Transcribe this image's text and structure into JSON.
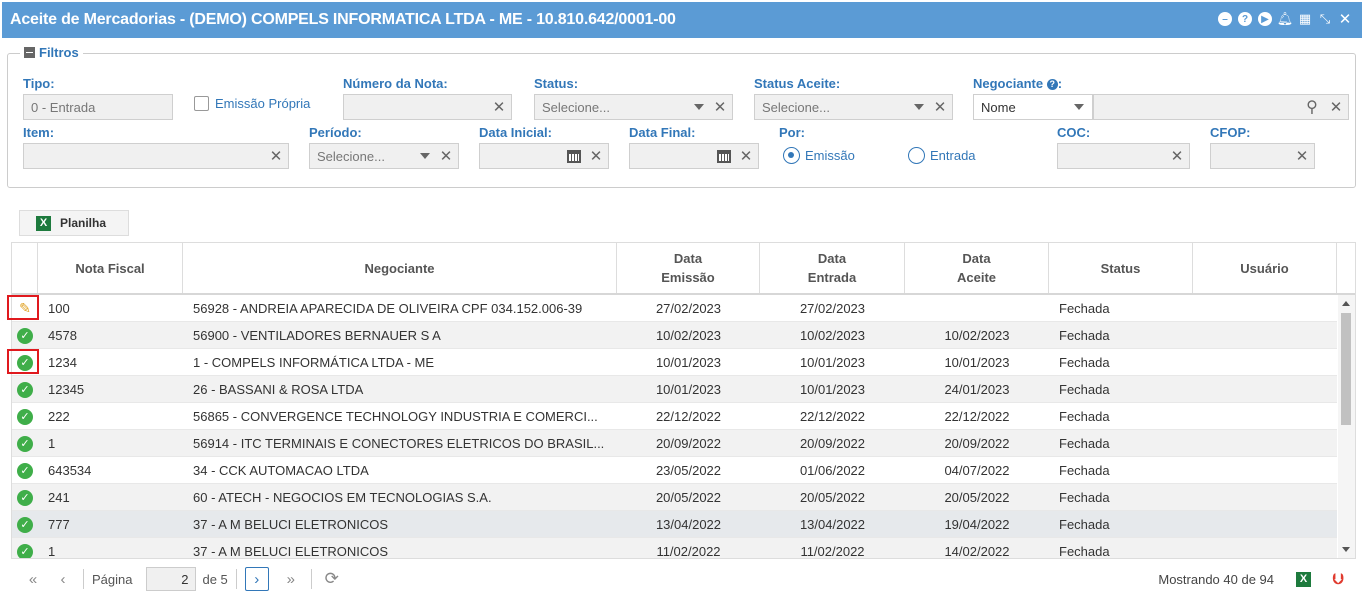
{
  "window": {
    "title": "Aceite de Mercadorias - (DEMO) COMPELS INFORMATICA LTDA - ME - 10.810.642/0001-00",
    "icons": [
      "minimize-icon",
      "help-icon",
      "play-icon",
      "bell-icon",
      "calendar-icon",
      "compress-icon",
      "close-icon"
    ]
  },
  "filters": {
    "legend": "Filtros",
    "tipo": {
      "label": "Tipo:",
      "value": "0 - Entrada"
    },
    "emissao_propria": {
      "label": "Emissão Própria",
      "checked": false
    },
    "numero_nota": {
      "label": "Número da Nota:",
      "value": ""
    },
    "status": {
      "label": "Status:",
      "placeholder": "Selecione..."
    },
    "status_aceite": {
      "label": "Status Aceite:",
      "placeholder": "Selecione..."
    },
    "negociante": {
      "label": "Negociante",
      "label_suffix": ":",
      "type_value": "Nome",
      "value": ""
    },
    "item": {
      "label": "Item:",
      "value": ""
    },
    "periodo": {
      "label": "Período:",
      "placeholder": "Selecione..."
    },
    "data_inicial": {
      "label": "Data Inicial:",
      "value": ""
    },
    "data_final": {
      "label": "Data Final:",
      "value": ""
    },
    "por": {
      "label": "Por:",
      "options": [
        "Emissão",
        "Entrada"
      ],
      "selected": "Emissão"
    },
    "coc": {
      "label": "COC:",
      "value": ""
    },
    "cfop": {
      "label": "CFOP:",
      "value": ""
    }
  },
  "toolbar": {
    "planilha_label": "Planilha"
  },
  "grid": {
    "columns": [
      "Nota Fiscal",
      "Negociante",
      "Data\nEmissão",
      "Data\nEntrada",
      "Data\nAceite",
      "Status",
      "Usuário"
    ],
    "rows": [
      {
        "icon": "edit-icon",
        "nota": "100",
        "negociante": "56928 - ANDREIA APARECIDA DE OLIVEIRA CPF 034.152.006-39",
        "emissao": "27/02/2023",
        "entrada": "27/02/2023",
        "aceite": "",
        "status": "Fechada",
        "usuario": ""
      },
      {
        "icon": "check-icon",
        "nota": "4578",
        "negociante": "56900 - VENTILADORES BERNAUER S A",
        "emissao": "10/02/2023",
        "entrada": "10/02/2023",
        "aceite": "10/02/2023",
        "status": "Fechada",
        "usuario": ""
      },
      {
        "icon": "check-icon",
        "nota": "1234",
        "negociante": "1 - COMPELS INFORMÁTICA LTDA - ME",
        "emissao": "10/01/2023",
        "entrada": "10/01/2023",
        "aceite": "10/01/2023",
        "status": "Fechada",
        "usuario": ""
      },
      {
        "icon": "check-icon",
        "nota": "12345",
        "negociante": "26 - BASSANI & ROSA LTDA",
        "emissao": "10/01/2023",
        "entrada": "10/01/2023",
        "aceite": "24/01/2023",
        "status": "Fechada",
        "usuario": ""
      },
      {
        "icon": "check-icon",
        "nota": "222",
        "negociante": "56865 - CONVERGENCE TECHNOLOGY INDUSTRIA E COMERCI...",
        "emissao": "22/12/2022",
        "entrada": "22/12/2022",
        "aceite": "22/12/2022",
        "status": "Fechada",
        "usuario": ""
      },
      {
        "icon": "check-icon",
        "nota": "1",
        "negociante": "56914 - ITC TERMINAIS E CONECTORES ELETRICOS DO BRASIL...",
        "emissao": "20/09/2022",
        "entrada": "20/09/2022",
        "aceite": "20/09/2022",
        "status": "Fechada",
        "usuario": ""
      },
      {
        "icon": "check-icon",
        "nota": "643534",
        "negociante": "34 - CCK AUTOMACAO LTDA",
        "emissao": "23/05/2022",
        "entrada": "01/06/2022",
        "aceite": "04/07/2022",
        "status": "Fechada",
        "usuario": ""
      },
      {
        "icon": "check-icon",
        "nota": "241",
        "negociante": "60 - ATECH - NEGOCIOS EM TECNOLOGIAS S.A.",
        "emissao": "20/05/2022",
        "entrada": "20/05/2022",
        "aceite": "20/05/2022",
        "status": "Fechada",
        "usuario": ""
      },
      {
        "icon": "check-icon",
        "nota": "777",
        "negociante": "37 - A M BELUCI ELETRONICOS",
        "emissao": "13/04/2022",
        "entrada": "13/04/2022",
        "aceite": "19/04/2022",
        "status": "Fechada",
        "usuario": ""
      },
      {
        "icon": "check-icon",
        "nota": "1",
        "negociante": "37 - A M BELUCI ELETRONICOS",
        "emissao": "11/02/2022",
        "entrada": "11/02/2022",
        "aceite": "14/02/2022",
        "status": "Fechada",
        "usuario": ""
      }
    ]
  },
  "pager": {
    "page_label": "Página",
    "page": "2",
    "of_label": "de 5",
    "summary": "Mostrando 40 de 94"
  },
  "colors": {
    "titlebar": "#5b9bd5",
    "accent": "#3277b8",
    "ok": "#3fae49",
    "highlight": "#e0191e"
  }
}
